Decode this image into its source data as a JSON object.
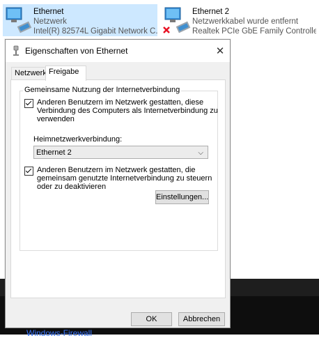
{
  "network_list": [
    {
      "name": "Ethernet",
      "type": "Netzwerk",
      "adapter": "Intel(R) 82574L Gigabit Network C...",
      "selected": true,
      "status_icon": "network-adapter-icon"
    },
    {
      "name": "Ethernet 2",
      "type": "Netzwerkkabel wurde entfernt",
      "adapter": "Realtek PCIe GbE Family Controller",
      "selected": false,
      "status_icon": "network-adapter-disconnected-icon"
    }
  ],
  "dialog": {
    "title": "Eigenschaften von Ethernet",
    "tabs": [
      "Netzwerk",
      "Freigabe"
    ],
    "active_tab": "Freigabe",
    "group_title": "Gemeinsame Nutzung der Internetverbindung",
    "checkbox1": {
      "label": "Anderen Benutzern im Netzwerk gestatten, diese Verbindung des Computers als Internetverbindung zu verwenden",
      "checked": true
    },
    "home_label": "Heimnetzwerkverbindung:",
    "home_value": "Ethernet 2",
    "checkbox2": {
      "label": "Anderen Benutzern im Netzwerk gestatten, die gemeinsam genutzte Internetverbindung zu steuern oder zu deaktivieren",
      "checked": true
    },
    "settings_button": "Einstellungen...",
    "ok_button": "OK",
    "cancel_button": "Abbrechen"
  },
  "background_link": "Windows-Firewall",
  "colors": {
    "selection": "#cde8ff",
    "dialog_bg": "#f0f0f0",
    "link": "#3b78ff",
    "error_x": "#e81123"
  }
}
